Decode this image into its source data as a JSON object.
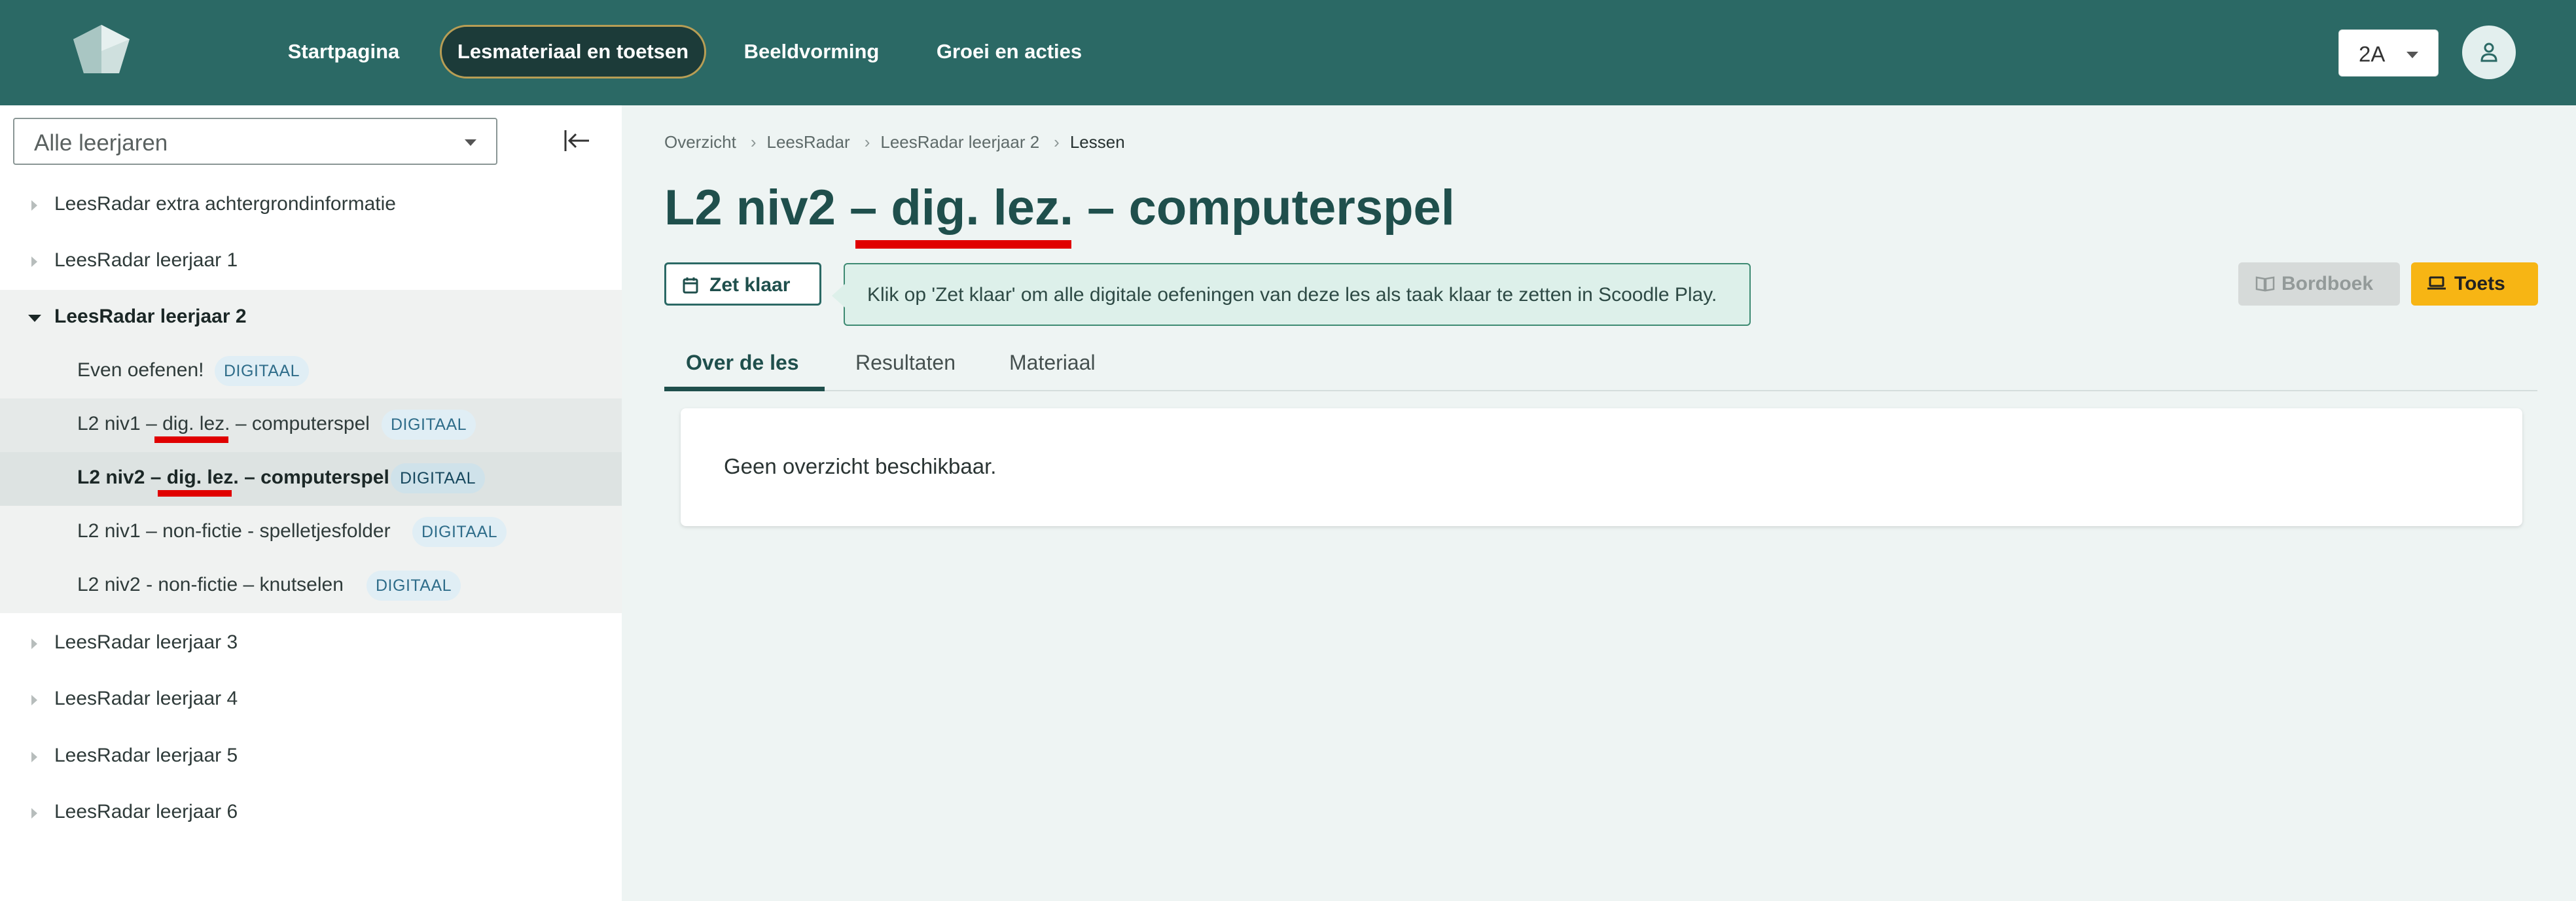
{
  "header": {
    "logo": "scoodle-logo-icon",
    "nav": [
      {
        "label": "Startpagina"
      },
      {
        "label": "Lesmateriaal en toetsen"
      },
      {
        "label": "Beeldvorming"
      },
      {
        "label": "Groei en acties"
      }
    ],
    "class_select": {
      "value": "2A"
    },
    "avatar_icon": "user-icon",
    "colors": {
      "bar": "#2b6965",
      "active_pill": "#1c3b39"
    }
  },
  "sidebar": {
    "year_select": {
      "value": "Alle leerjaren"
    },
    "collapse_icon": "collapse-left-icon",
    "tree": [
      {
        "label": "LeesRadar extra achtergrondinformatie"
      },
      {
        "label": "LeesRadar leerjaar 1"
      },
      {
        "label": "LeesRadar leerjaar 2",
        "expanded": true
      },
      {
        "label": "Even oefenen!",
        "badge": "DIGITAAL"
      },
      {
        "label": "L2 niv1 – dig. lez. – computerspel",
        "badge": "DIGITAAL"
      },
      {
        "label": "L2 niv2 – dig. lez. – computerspel",
        "badge": "DIGITAAL",
        "selected": true
      },
      {
        "label": "L2 niv1 – non-fictie - spelletjesfolder",
        "badge": "DIGITAAL"
      },
      {
        "label": "L2 niv2 - non-fictie – knutselen",
        "badge": "DIGITAAL"
      },
      {
        "label": "LeesRadar leerjaar 3"
      },
      {
        "label": "LeesRadar leerjaar 4"
      },
      {
        "label": "LeesRadar leerjaar 5"
      },
      {
        "label": "LeesRadar leerjaar 6"
      }
    ]
  },
  "main": {
    "breadcrumb": [
      "Overzicht",
      "LeesRadar",
      "LeesRadar leerjaar 2",
      "Lessen"
    ],
    "breadcrumb_sep": "›",
    "title": "L2 niv2 – dig. lez. – computerspel",
    "zet_klaar": {
      "label": "Zet klaar",
      "icon": "calendar-icon"
    },
    "tooltip": "Klik op 'Zet klaar' om alle digitale oefeningen van deze les als taak klaar te zetten in Scoodle Play.",
    "bordboek": {
      "label": "Bordboek",
      "icon": "book-icon",
      "disabled": true
    },
    "toets": {
      "label": "Toets",
      "icon": "laptop-icon",
      "color": "#f7b514"
    },
    "tabs": [
      {
        "label": "Over de les",
        "active": true
      },
      {
        "label": "Resultaten"
      },
      {
        "label": "Materiaal"
      }
    ],
    "card_text": "Geen overzicht beschikbaar."
  },
  "annotation_color": "#e00000"
}
